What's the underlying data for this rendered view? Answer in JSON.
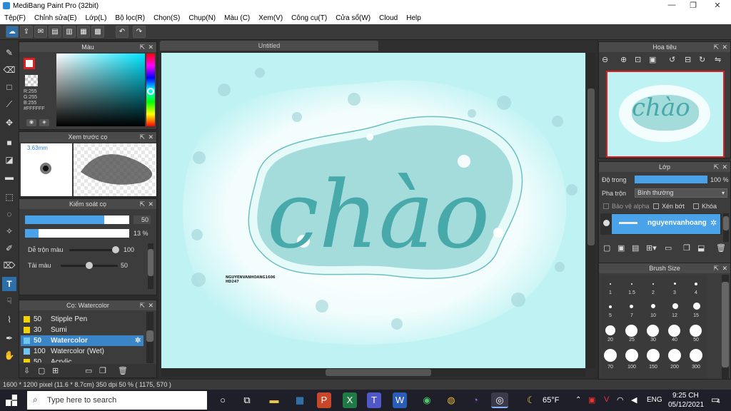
{
  "window": {
    "title": "MediBang Paint Pro (32bit)",
    "min": "—",
    "max": "❐",
    "close": "✕"
  },
  "menu": [
    "Tệp(F)",
    "Chỉnh sửa(E)",
    "Lớp(L)",
    "Bộ lọc(R)",
    "Chọn(S)",
    "Chụp(N)",
    "Màu (C)",
    "Xem(V)",
    "Công cụ(T)",
    "Cửa sổ(W)",
    "Cloud",
    "Help"
  ],
  "color_panel": {
    "title": "Màu",
    "r": "R:255",
    "g": "G:255",
    "b": "B:255",
    "hex": "#FFFFFF"
  },
  "brush_preview": {
    "title": "Xem trước cọ",
    "size": "3.63mm"
  },
  "brush_control": {
    "title": "Kiểm soát cọ",
    "size_value": "50",
    "opacity_value": "13 %",
    "blend_label": "Dễ trộn màu",
    "blend_value": "100",
    "reload_label": "Tải màu",
    "reload_value": "50"
  },
  "brush_list": {
    "title": "Cọ: Watercolor",
    "items": [
      {
        "size": "50",
        "name": "Stipple Pen",
        "color": "#f2d200",
        "selected": false
      },
      {
        "size": "30",
        "name": "Sumi",
        "color": "#f2d200",
        "selected": false
      },
      {
        "size": "50",
        "name": "Watercolor",
        "color": "#6ec6f0",
        "selected": true
      },
      {
        "size": "100",
        "name": "Watercolor (Wet)",
        "color": "#6ec6f0",
        "selected": false
      },
      {
        "size": "50",
        "name": "Acrylic",
        "color": "#f2d200",
        "selected": false
      }
    ]
  },
  "canvas": {
    "tab": "Untitled",
    "word": "chào",
    "signature_line1": "NGUYENVANHOANG1606",
    "signature_line2": "HD247"
  },
  "navigator": {
    "title": "Hoa tiêu",
    "thumb_word": "chào"
  },
  "layer_panel": {
    "title": "Lớp",
    "opacity_label": "Độ trong",
    "opacity_value": "100 %",
    "blend_label": "Pha trộn",
    "blend_value": "Bình thường",
    "protect_alpha": "Bảo vệ alpha",
    "clipping": "Xén bớt",
    "lock": "Khóa",
    "layer_name": "nguyenvanhoang"
  },
  "brush_size": {
    "title": "Brush Size",
    "sizes": [
      "1",
      "1.5",
      "2",
      "3",
      "4",
      "5",
      "7",
      "10",
      "12",
      "15",
      "20",
      "25",
      "30",
      "40",
      "50",
      "70",
      "100",
      "150",
      "200",
      "300"
    ]
  },
  "status": {
    "text": "1600 * 1200 pixel   (11.6 * 8.7cm)   350 dpi   50 %   ( 1175, 570 )"
  },
  "taskbar": {
    "search_placeholder": "Type here to search",
    "weather": "65°F",
    "lang": "ENG",
    "time": "9:25 CH",
    "date": "05/12/2021",
    "notif": "4"
  }
}
